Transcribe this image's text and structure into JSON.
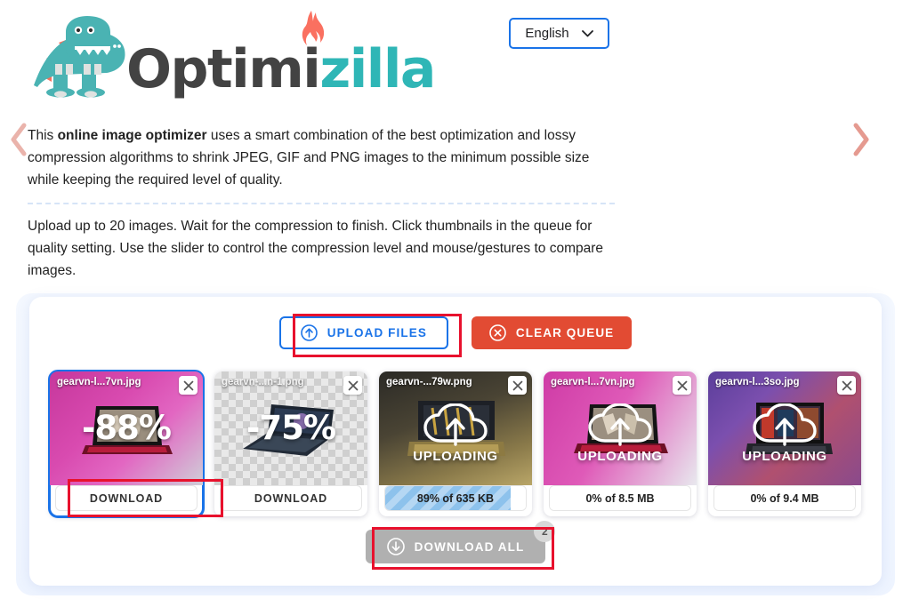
{
  "brand": {
    "name_part1": "Optim",
    "name_part2": "i",
    "name_part3": "zilla",
    "mascot_icon": "dinosaur-mascot-icon",
    "flame_icon": "flame-icon"
  },
  "language_selector": {
    "value": "English",
    "chevron_icon": "chevron-down-icon"
  },
  "description": {
    "paragraph1_pre": "This ",
    "paragraph1_bold": "online image optimizer",
    "paragraph1_post": " uses a smart combination of the best optimization and lossy compression algorithms to shrink JPEG, GIF and PNG images to the minimum possible size while keeping the required level of quality.",
    "paragraph2": "Upload up to 20 images. Wait for the compression to finish. Click thumbnails in the queue for quality setting. Use the slider to control the compression level and mouse/gestures to compare images."
  },
  "toolbar": {
    "upload_label": "UPLOAD FILES",
    "upload_icon": "upload-arrow-circle-icon",
    "clear_label": "CLEAR QUEUE",
    "clear_icon": "close-circle-icon"
  },
  "queue": {
    "prev_icon": "chevron-left-icon",
    "next_icon": "chevron-right-icon",
    "close_icon": "close-icon",
    "cloud_upload_icon": "cloud-upload-icon",
    "items": [
      {
        "filename": "gearvn-l...7vn.jpg",
        "state": "done",
        "savings": "-88%",
        "action_label": "DOWNLOAD",
        "selected": true,
        "art": "img-pink"
      },
      {
        "filename": "gearvn-...n-1.png",
        "state": "done",
        "savings": "-75%",
        "action_label": "DOWNLOAD",
        "selected": false,
        "art": "img-checker"
      },
      {
        "filename": "gearvn-...79w.png",
        "state": "uploading",
        "status_label": "UPLOADING",
        "progress_text": "89% of 635 KB",
        "progress_percent": 89,
        "selected": false,
        "art": "img-dark"
      },
      {
        "filename": "gearvn-l...7vn.jpg",
        "state": "uploading",
        "status_label": "UPLOADING",
        "progress_text": "0% of 8.5 MB",
        "progress_percent": 0,
        "selected": false,
        "art": "img-pink2"
      },
      {
        "filename": "gearvn-l...3so.jpg",
        "state": "uploading",
        "status_label": "UPLOADING",
        "progress_text": "0% of 9.4 MB",
        "progress_percent": 0,
        "selected": false,
        "art": "img-purple"
      }
    ]
  },
  "footer": {
    "download_all_label": "DOWNLOAD ALL",
    "download_all_icon": "download-arrow-circle-icon",
    "download_all_count": "2"
  },
  "colors": {
    "brand_teal": "#2fb6b6",
    "brand_dark": "#434343",
    "accent_blue": "#1a73e8",
    "clear_red": "#e24b33",
    "annotation_red": "#e8112d",
    "disabled_gray": "#b0b0b0",
    "arrow_pink": "#e8a9a0"
  }
}
